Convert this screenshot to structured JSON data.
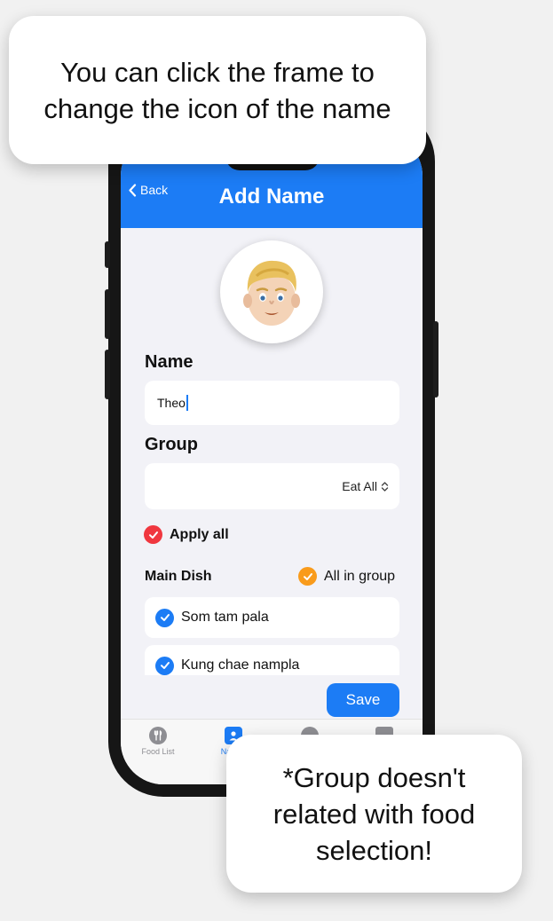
{
  "callouts": {
    "top": [
      "You can click the frame to",
      "change the icon of the name"
    ],
    "bottom": [
      "*Group doesn't",
      "related with food",
      "selection!"
    ]
  },
  "nav": {
    "back_label": "Back",
    "title": "Add Name"
  },
  "avatar": {
    "emoji": "👱🏻‍♂️",
    "icon": "blond-man-emoji"
  },
  "form": {
    "name_label": "Name",
    "name_value": "Theo",
    "group_label": "Group",
    "group_value": "Eat All",
    "apply_all_label": "Apply all"
  },
  "section": {
    "title": "Main Dish",
    "all_in_group_label": "All in group"
  },
  "foods": [
    {
      "label": "Som tam pala",
      "checked": true
    },
    {
      "label": "Kung chae nampla",
      "checked": true
    }
  ],
  "save_label": "Save",
  "tabs": [
    {
      "label": "Food List",
      "icon": "fork-knife-icon"
    },
    {
      "label": "Names",
      "icon": "person-badge-icon"
    },
    {
      "label": "",
      "icon": "circle-icon"
    },
    {
      "label": "",
      "icon": "clipboard-icon"
    }
  ],
  "colors": {
    "accent": "#1c7cf5",
    "apply_all_check": "#f0373f",
    "group_check": "#f99b1b",
    "food_check": "#1c7cf5"
  }
}
